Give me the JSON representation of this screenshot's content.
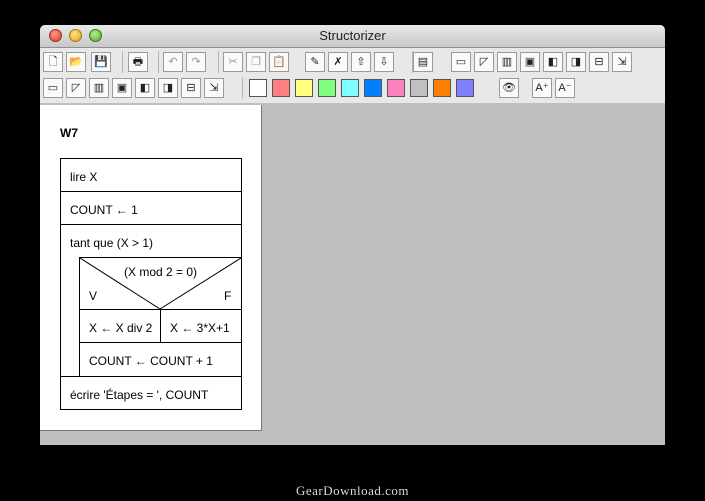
{
  "window": {
    "title": "Structorizer"
  },
  "toolbar": {
    "row1": [
      {
        "name": "new-icon",
        "glyph": "🗋"
      },
      {
        "name": "open-icon",
        "glyph": "📂"
      },
      {
        "name": "save-icon",
        "glyph": "💾"
      },
      {
        "name": "print-icon",
        "glyph": "🖶"
      },
      {
        "name": "undo-icon",
        "glyph": "↶"
      },
      {
        "name": "redo-icon",
        "glyph": "↷"
      },
      {
        "name": "cut-icon",
        "glyph": "✂"
      },
      {
        "name": "copy-icon",
        "glyph": "❐"
      },
      {
        "name": "paste-icon",
        "glyph": "📋"
      },
      {
        "name": "edit-icon",
        "glyph": "✎"
      },
      {
        "name": "delete-icon",
        "glyph": "✗"
      },
      {
        "name": "move-up-icon",
        "glyph": "⇧"
      },
      {
        "name": "move-down-icon",
        "glyph": "⇩"
      },
      {
        "name": "properties-icon",
        "glyph": "▤"
      },
      {
        "name": "add-instruction-icon",
        "glyph": "▭"
      },
      {
        "name": "add-alternative-icon",
        "glyph": "◸"
      },
      {
        "name": "add-case-icon",
        "glyph": "▥"
      },
      {
        "name": "add-for-icon",
        "glyph": "▣"
      },
      {
        "name": "add-while-icon",
        "glyph": "◧"
      },
      {
        "name": "add-repeat-icon",
        "glyph": "◨"
      },
      {
        "name": "add-call-icon",
        "glyph": "⊟"
      },
      {
        "name": "add-jump-icon",
        "glyph": "⇲"
      }
    ],
    "row2": [
      {
        "name": "add-instruction-after-icon",
        "glyph": "▭"
      },
      {
        "name": "add-alternative-after-icon",
        "glyph": "◸"
      },
      {
        "name": "add-case-after-icon",
        "glyph": "▥"
      },
      {
        "name": "add-for-after-icon",
        "glyph": "▣"
      },
      {
        "name": "add-while-after-icon",
        "glyph": "◧"
      },
      {
        "name": "add-repeat-after-icon",
        "glyph": "◨"
      },
      {
        "name": "add-call-after-icon",
        "glyph": "⊟"
      },
      {
        "name": "add-jump-after-icon",
        "glyph": "⇲"
      },
      {
        "name": "eye-icon",
        "glyph": "👁"
      },
      {
        "name": "font-increase-icon",
        "glyph": "A⁺"
      },
      {
        "name": "font-decrease-icon",
        "glyph": "A⁻"
      }
    ],
    "colors": [
      "#ffffff",
      "#ff8080",
      "#ffff80",
      "#80ff80",
      "#80ffff",
      "#0080ff",
      "#ff80c0",
      "#c0c0c0",
      "#ff8000",
      "#8080ff"
    ]
  },
  "diagram": {
    "title": "W7",
    "lines": {
      "read": "lire X",
      "init": "COUNT ← 1",
      "while_cond": "tant que (X > 1)",
      "if_cond": "(X mod 2 = 0)",
      "true_label": "V",
      "false_label": "F",
      "then_branch": "X ← X div 2",
      "else_branch": "X ← 3*X+1",
      "increment": "COUNT ← COUNT + 1",
      "write": "écrire 'Étapes = ', COUNT"
    }
  },
  "watermark": "GearDownload.com"
}
